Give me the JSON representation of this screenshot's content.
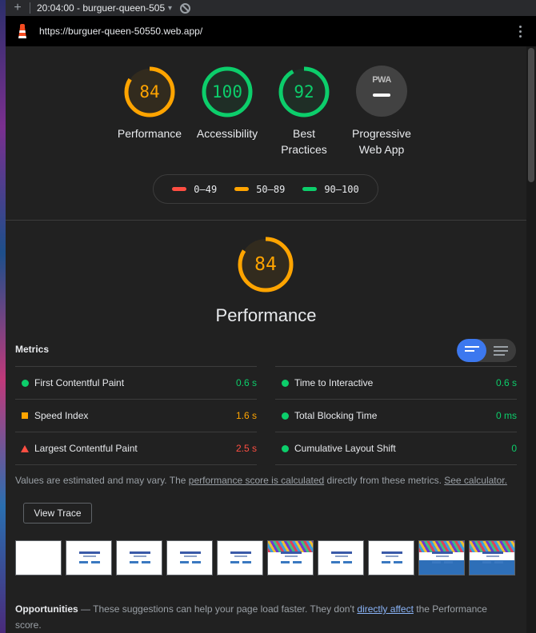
{
  "tabbar": {
    "new_tab": "+",
    "session": "20:04:00 - burguer-queen-505",
    "caret": "▾"
  },
  "urlbar": {
    "url": "https://burguer-queen-50550.web.app/"
  },
  "colors": {
    "pass": "#0cce6b",
    "average": "#ffa400",
    "fail": "#ff4e42",
    "accent": "#3c78ef"
  },
  "categories": [
    {
      "score": "84",
      "label": "Performance",
      "color": "#ffa400",
      "fraction": 0.84
    },
    {
      "score": "100",
      "label": "Accessibility",
      "color": "#0cce6b",
      "fraction": 1.0
    },
    {
      "score": "92",
      "label_line1": "Best",
      "label_line2": "Practices",
      "color": "#0cce6b",
      "fraction": 0.92
    },
    {
      "badge": "PWA",
      "label_line1": "Progressive",
      "label_line2": "Web App"
    }
  ],
  "legend": [
    {
      "range": "0–49",
      "color": "#ff4e42"
    },
    {
      "range": "50–89",
      "color": "#ffa400"
    },
    {
      "range": "90–100",
      "color": "#0cce6b"
    }
  ],
  "performance": {
    "score": "84",
    "fraction": 0.84,
    "title": "Performance"
  },
  "metrics": {
    "heading": "Metrics",
    "left": [
      {
        "name": "First Contentful Paint",
        "value": "0.6 s",
        "status": "pass"
      },
      {
        "name": "Speed Index",
        "value": "1.6 s",
        "status": "average"
      },
      {
        "name": "Largest Contentful Paint",
        "value": "2.5 s",
        "status": "fail"
      }
    ],
    "right": [
      {
        "name": "Time to Interactive",
        "value": "0.6 s",
        "status": "pass"
      },
      {
        "name": "Total Blocking Time",
        "value": "0 ms",
        "status": "pass"
      },
      {
        "name": "Cumulative Layout Shift",
        "value": "0",
        "status": "pass"
      }
    ]
  },
  "note": {
    "text1": "Values are estimated and may vary. The ",
    "link1": "performance score is calculated",
    "text2": " directly from these metrics. ",
    "link2": "See calculator."
  },
  "view_trace": "View Trace",
  "filmstrip_frames": 10,
  "opportunities": {
    "heading": "Opportunities",
    "dash": " — ",
    "text1": "These suggestions can help your page load faster. They don't ",
    "link": "directly affect",
    "text2": " the Performance score."
  }
}
